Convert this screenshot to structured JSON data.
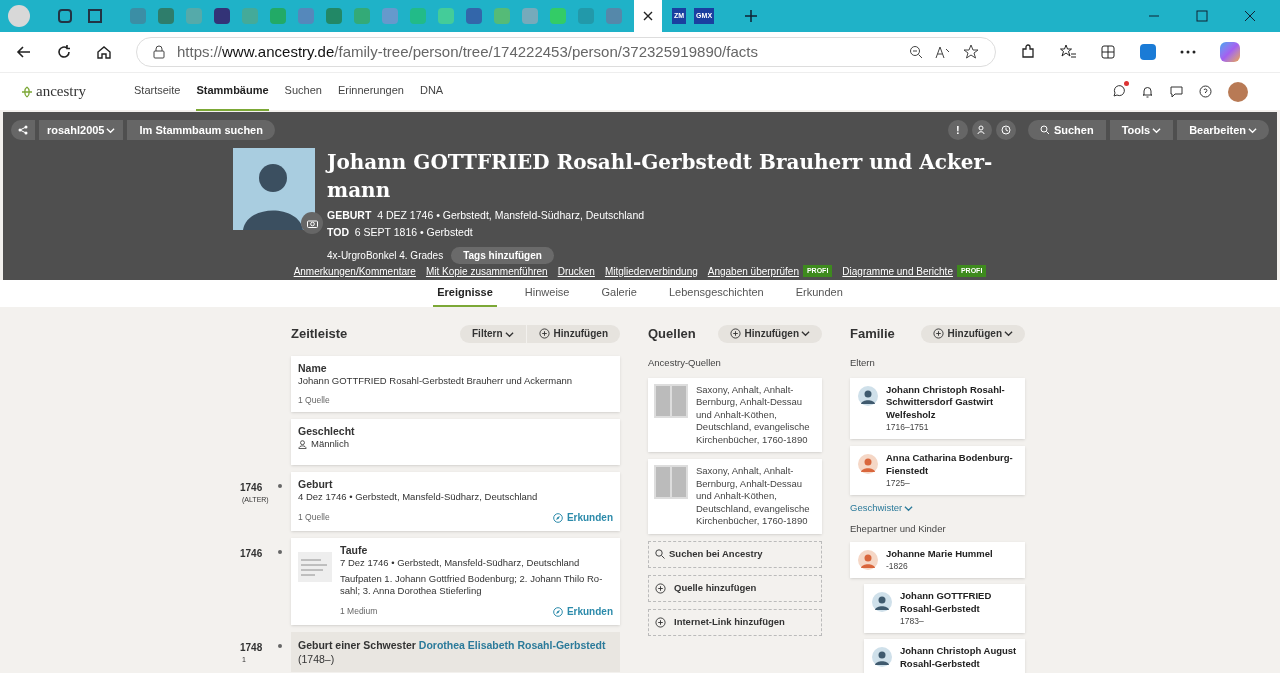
{
  "browser": {
    "favicon_texts": [
      "ZM",
      "GMX"
    ],
    "url_prefix": "https://",
    "url_host": "www.ancestry.de",
    "url_path": "/family-tree/person/tree/174222453/person/372325919890/facts"
  },
  "site_nav": {
    "logo": "ancestry",
    "items": [
      {
        "label": "Startseite",
        "selected": false
      },
      {
        "label": "Stammbäume",
        "selected": true
      },
      {
        "label": "Suchen",
        "selected": false
      },
      {
        "label": "Erinnerungen",
        "selected": false
      },
      {
        "label": "DNA",
        "selected": false
      }
    ]
  },
  "tree_bar": {
    "tree_name": "rosahl2005",
    "search_tree": "Im Stammbaum suchen",
    "alert": "!",
    "buttons": [
      "Suchen",
      "Tools",
      "Bearbeiten"
    ]
  },
  "person": {
    "name": "Johann GOTTFRIED Rosahl-Gerbstedt Brauherr und Acker-mann",
    "birth_label": "GEBURT",
    "birth": "4 DEZ 1746 • Gerbstedt, Mansfeld-Südharz, Deutschland",
    "death_label": "TOD",
    "death": "6 SEPT 1816 • Gerbstedt",
    "relation": "4x-UrgroBonkel 4. Grades",
    "tags_button": "Tags hinzufügen"
  },
  "actions": [
    {
      "label": "Anmerkungen/Kommentare"
    },
    {
      "label": "Mit Kopie zusammenführen"
    },
    {
      "label": "Drucken"
    },
    {
      "label": "Mitgliederverbindung"
    },
    {
      "label": "Angaben überprüfen",
      "badge": "PROFI"
    },
    {
      "label": "Diagramme und Berichte",
      "badge": "PROFI"
    }
  ],
  "tabs": [
    {
      "label": "Ereignisse",
      "selected": true
    },
    {
      "label": "Hinweise",
      "selected": false
    },
    {
      "label": "Galerie",
      "selected": false
    },
    {
      "label": "Lebensgeschichten",
      "selected": false
    },
    {
      "label": "Erkunden",
      "selected": false
    }
  ],
  "timeline": {
    "title": "Zeitleiste",
    "filter": "Filtern",
    "add": "Hinzufügen",
    "events": [
      {
        "kind": "fact",
        "title": "Name",
        "detail": "Johann GOTTFRIED Rosahl-Gerbstedt Brauherr und Ackermann",
        "footer": "1 Quelle"
      },
      {
        "kind": "gender",
        "title": "Geschlecht",
        "detail": "Männlich"
      },
      {
        "kind": "fact",
        "year": "1746",
        "year_note": "(ALTER)",
        "title": "Geburt",
        "detail": "4 Dez 1746 • Gerbstedt, Mansfeld-Südharz, Deutschland",
        "footer": "1 Quelle",
        "explore": "Erkunden"
      },
      {
        "kind": "media",
        "year": "1746",
        "title": "Taufe",
        "detail": "7 Dez 1746 • Gerbstedt, Mansfeld-Südharz, Deutschland",
        "note": "Taufpaten 1. Johann Gottfried Bodenburg; 2. Johann Thilo Ro-sahl; 3. Anna Dorothea Stieferling",
        "footer": "1 Medium",
        "explore": "Erkunden"
      },
      {
        "kind": "relative",
        "year": "1748",
        "year_note": "1",
        "title": "Geburt einer Schwester",
        "link": "Dorothea Elisabeth Rosahl-Gerbstedt",
        "suffix": "(1748–)"
      }
    ]
  },
  "sources": {
    "title": "Quellen",
    "add": "Hinzufügen",
    "subtitle": "Ancestry-Quellen",
    "items": [
      "Saxony, Anhalt, Anhalt-Bernburg, Anhalt-Dessau und Anhalt-Köthen, Deutschland, evangelische Kirchenbücher, 1760-1890",
      "Saxony, Anhalt, Anhalt-Bernburg, Anhalt-Dessau und Anhalt-Köthen, Deutschland, evangelische Kirchenbücher, 1760-1890"
    ],
    "links": [
      {
        "kind": "search",
        "label": "Suchen bei Ancestry"
      },
      {
        "kind": "add",
        "label": "Quelle hinzufügen"
      },
      {
        "kind": "add",
        "label": "Internet-Link hinzufügen"
      }
    ]
  },
  "family": {
    "title": "Familie",
    "add": "Hinzufügen",
    "parents_label": "Eltern",
    "parents": [
      {
        "kind": "male",
        "name": "Johann Christoph Rosahl-Schwittersdorf Gastwirt Welfesholz",
        "dates": "1716–1751"
      },
      {
        "kind": "female",
        "name": "Anna Catharina Bodenburg-Fienstedt",
        "dates": "1725–"
      }
    ],
    "siblings": "Geschwister",
    "spouses_label": "Ehepartner und Kinder",
    "spouses": [
      {
        "kind": "female",
        "name": "Johanne Marie Hummel",
        "dates": "-1826",
        "children": [
          {
            "kind": "male",
            "name": "Johann GOTTFRIED Rosahl-Gerbstedt",
            "dates": "1783–"
          },
          {
            "kind": "male",
            "name": "Johann Christoph August Rosahl-Gerbstedt"
          }
        ]
      }
    ]
  }
}
